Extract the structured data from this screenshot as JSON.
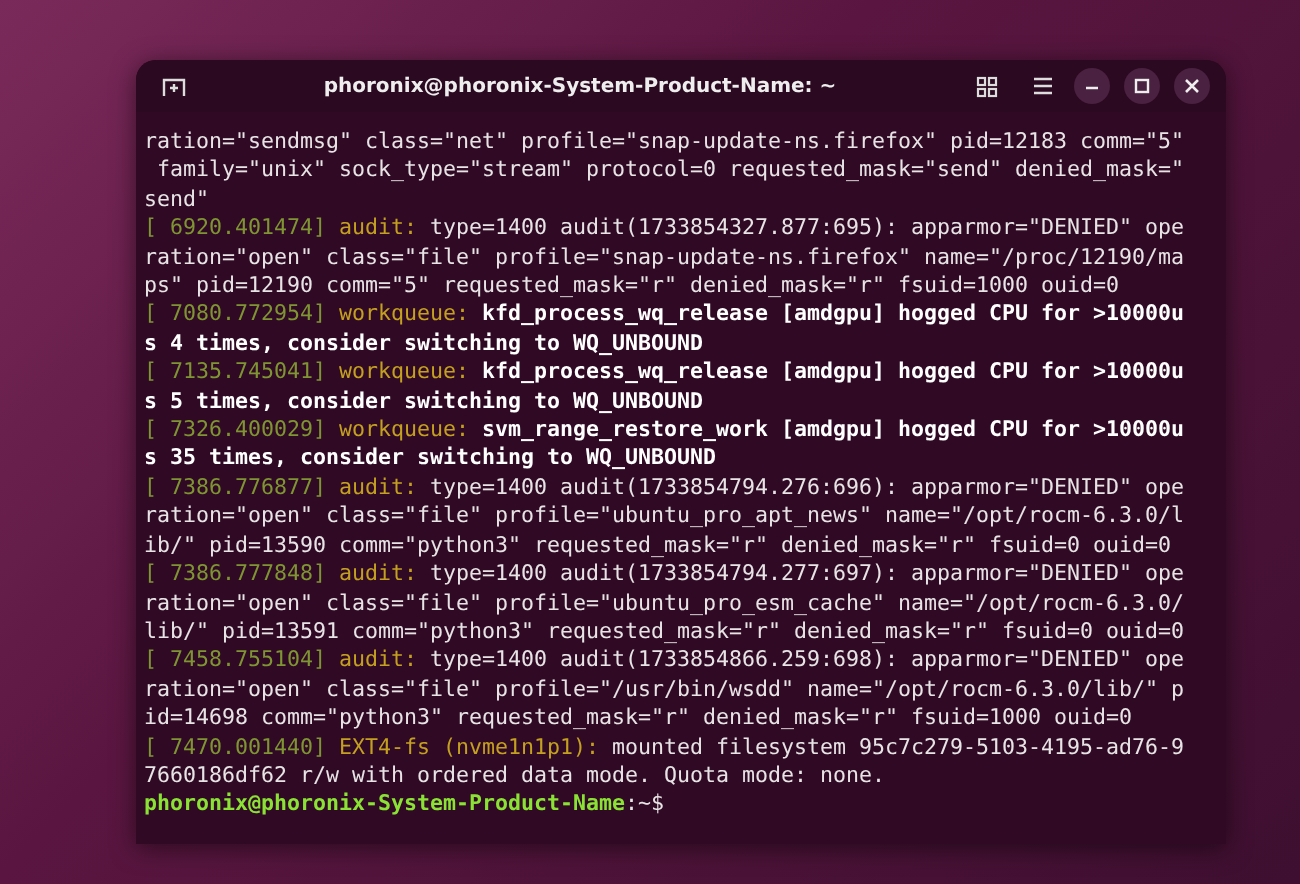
{
  "window": {
    "title": "phoronix@phoronix-System-Product-Name: ~"
  },
  "lines": [
    [
      {
        "kind": "text",
        "t": "ration=\"sendmsg\" class=\"net\" profile=\"snap-update-ns.firefox\" pid=12183 comm=\"5\""
      }
    ],
    [
      {
        "kind": "text",
        "t": " family=\"unix\" sock_type=\"stream\" protocol=0 requested_mask=\"send\" denied_mask=\""
      }
    ],
    [
      {
        "kind": "text",
        "t": "send\""
      }
    ],
    [
      {
        "kind": "ts",
        "t": "[ 6920.401474]"
      },
      {
        "kind": "facility",
        "t": "audit:"
      },
      {
        "kind": "text",
        "t": "type=1400 audit(1733854327.877:695): apparmor=\"DENIED\" ope"
      }
    ],
    [
      {
        "kind": "text",
        "t": "ration=\"open\" class=\"file\" profile=\"snap-update-ns.firefox\" name=\"/proc/12190/ma"
      }
    ],
    [
      {
        "kind": "text",
        "t": "ps\" pid=12190 comm=\"5\" requested_mask=\"r\" denied_mask=\"r\" fsuid=1000 ouid=0"
      }
    ],
    [
      {
        "kind": "ts",
        "t": "[ 7080.772954]"
      },
      {
        "kind": "facility",
        "t": "workqueue:"
      },
      {
        "kind": "bold",
        "t": "kfd_process_wq_release [amdgpu] hogged CPU for >10000u"
      }
    ],
    [
      {
        "kind": "bold",
        "t": "s 4 times, consider switching to WQ_UNBOUND"
      }
    ],
    [
      {
        "kind": "ts",
        "t": "[ 7135.745041]"
      },
      {
        "kind": "facility",
        "t": "workqueue:"
      },
      {
        "kind": "bold",
        "t": "kfd_process_wq_release [amdgpu] hogged CPU for >10000u"
      }
    ],
    [
      {
        "kind": "bold",
        "t": "s 5 times, consider switching to WQ_UNBOUND"
      }
    ],
    [
      {
        "kind": "ts",
        "t": "[ 7326.400029]"
      },
      {
        "kind": "facility",
        "t": "workqueue:"
      },
      {
        "kind": "bold",
        "t": "svm_range_restore_work [amdgpu] hogged CPU for >10000u"
      }
    ],
    [
      {
        "kind": "bold",
        "t": "s 35 times, consider switching to WQ_UNBOUND"
      }
    ],
    [
      {
        "kind": "ts",
        "t": "[ 7386.776877]"
      },
      {
        "kind": "facility",
        "t": "audit:"
      },
      {
        "kind": "text",
        "t": "type=1400 audit(1733854794.276:696): apparmor=\"DENIED\" ope"
      }
    ],
    [
      {
        "kind": "text",
        "t": "ration=\"open\" class=\"file\" profile=\"ubuntu_pro_apt_news\" name=\"/opt/rocm-6.3.0/l"
      }
    ],
    [
      {
        "kind": "text",
        "t": "ib/\" pid=13590 comm=\"python3\" requested_mask=\"r\" denied_mask=\"r\" fsuid=0 ouid=0"
      }
    ],
    [
      {
        "kind": "ts",
        "t": "[ 7386.777848]"
      },
      {
        "kind": "facility",
        "t": "audit:"
      },
      {
        "kind": "text",
        "t": "type=1400 audit(1733854794.277:697): apparmor=\"DENIED\" ope"
      }
    ],
    [
      {
        "kind": "text",
        "t": "ration=\"open\" class=\"file\" profile=\"ubuntu_pro_esm_cache\" name=\"/opt/rocm-6.3.0/"
      }
    ],
    [
      {
        "kind": "text",
        "t": "lib/\" pid=13591 comm=\"python3\" requested_mask=\"r\" denied_mask=\"r\" fsuid=0 ouid=0"
      }
    ],
    [
      {
        "kind": "ts",
        "t": "[ 7458.755104]"
      },
      {
        "kind": "facility",
        "t": "audit:"
      },
      {
        "kind": "text",
        "t": "type=1400 audit(1733854866.259:698): apparmor=\"DENIED\" ope"
      }
    ],
    [
      {
        "kind": "text",
        "t": "ration=\"open\" class=\"file\" profile=\"/usr/bin/wsdd\" name=\"/opt/rocm-6.3.0/lib/\" p"
      }
    ],
    [
      {
        "kind": "text",
        "t": "id=14698 comm=\"python3\" requested_mask=\"r\" denied_mask=\"r\" fsuid=1000 ouid=0"
      }
    ],
    [
      {
        "kind": "ts",
        "t": "[ 7470.001440]"
      },
      {
        "kind": "facility",
        "t": "EXT4-fs (nvme1n1p1):"
      },
      {
        "kind": "text",
        "t": "mounted filesystem 95c7c279-5103-4195-ad76-9"
      }
    ],
    [
      {
        "kind": "text",
        "t": "7660186df62 r/w with ordered data mode. Quota mode: none."
      }
    ],
    [
      {
        "kind": "user",
        "t": "phoronix@phoronix-System-Product-Name"
      },
      {
        "kind": "path",
        "t": ":~$"
      }
    ]
  ]
}
